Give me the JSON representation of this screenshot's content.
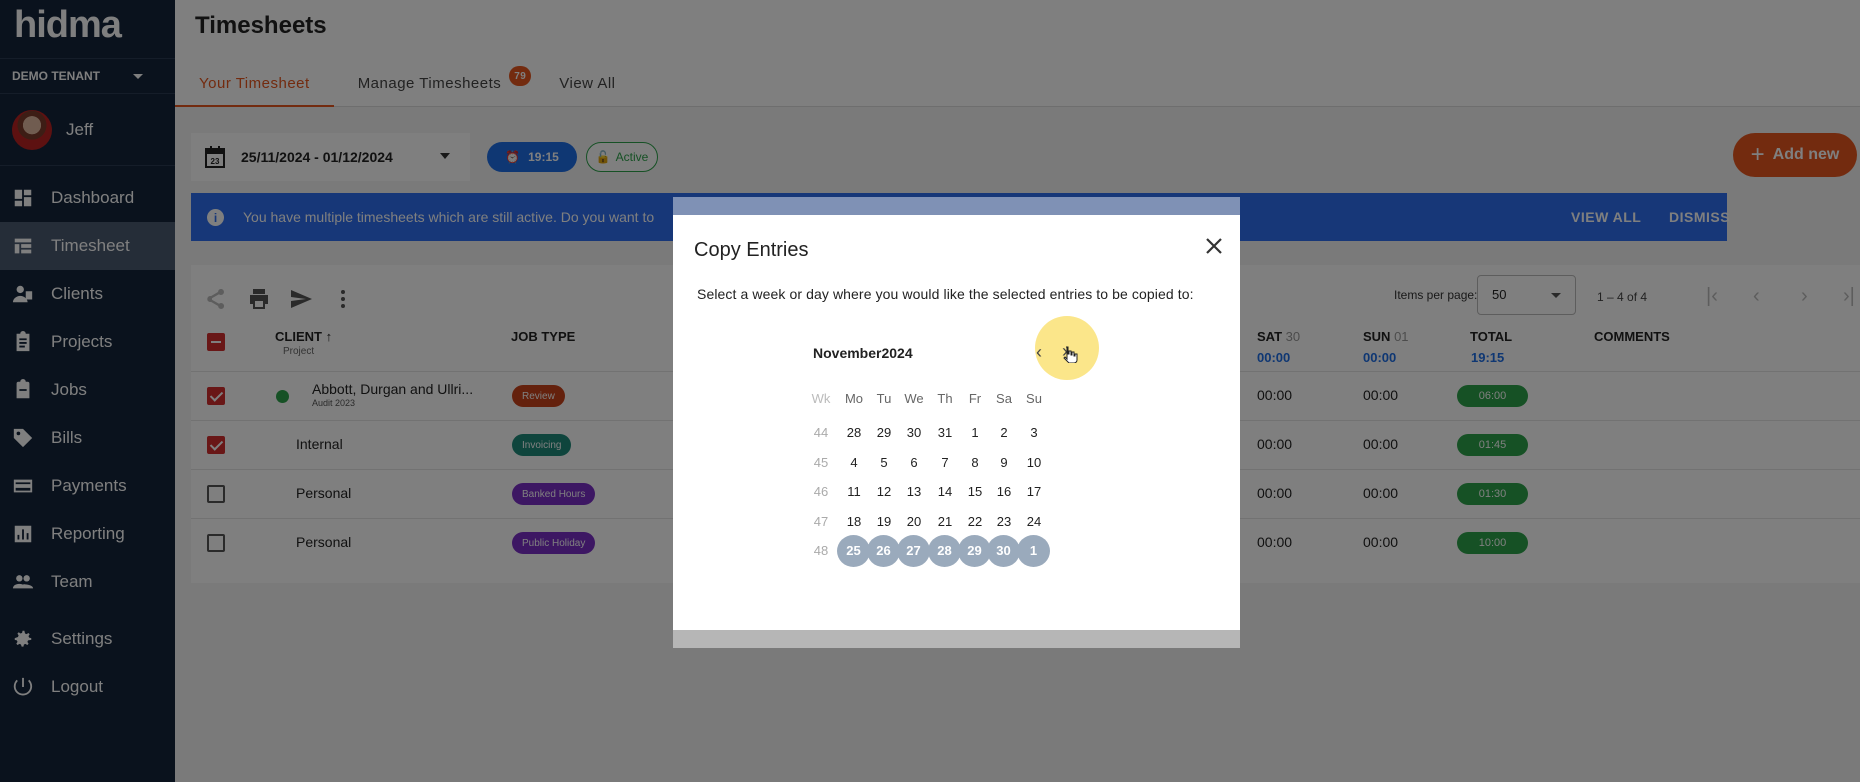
{
  "brand": {
    "logo": "hidma",
    "accent": "#e6561e"
  },
  "tenant": {
    "name": "DEMO TENANT"
  },
  "user": {
    "name": "Jeff"
  },
  "sidebar": {
    "items": [
      {
        "label": "Dashboard",
        "icon": "dashboard-icon"
      },
      {
        "label": "Timesheet",
        "icon": "table-icon",
        "active": true
      },
      {
        "label": "Clients",
        "icon": "clients-icon"
      },
      {
        "label": "Projects",
        "icon": "clipboard-icon"
      },
      {
        "label": "Jobs",
        "icon": "briefcase-icon"
      },
      {
        "label": "Bills",
        "icon": "tag-icon"
      },
      {
        "label": "Payments",
        "icon": "credit-card-icon"
      },
      {
        "label": "Reporting",
        "icon": "chart-icon"
      },
      {
        "label": "Team",
        "icon": "team-icon"
      }
    ],
    "bottom": [
      {
        "label": "Settings",
        "icon": "gear-icon"
      },
      {
        "label": "Logout",
        "icon": "power-icon"
      }
    ]
  },
  "header": {
    "title": "Timesheets",
    "tabs": [
      {
        "label": "Your Timesheet",
        "active": true
      },
      {
        "label": "Manage Timesheets",
        "badge": "79"
      },
      {
        "label": "View All"
      }
    ]
  },
  "toolbar": {
    "date_range": "25/11/2024 - 01/12/2024",
    "calendar_day": "23",
    "time_chip": "19:15",
    "status_chip": "Active",
    "add_new": "Add new"
  },
  "alert": {
    "text": "You have multiple timesheets which are still active. Do you want to",
    "view_all": "VIEW ALL",
    "dismiss": "DISMISS"
  },
  "table": {
    "items_per_page_label": "Items per page:",
    "items_per_page": "50",
    "range": "1 – 4 of 4",
    "headers": {
      "client": "CLIENT",
      "client_sub": "Project",
      "job_type": "JOB TYPE",
      "sat": "SAT",
      "sat_day": "30",
      "sat_val": "00:00",
      "sun": "SUN",
      "sun_day": "01",
      "sun_val": "00:00",
      "total": "TOTAL",
      "total_val": "19:15",
      "comments": "COMMENTS"
    },
    "rows": [
      {
        "client": "Abbott, Durgan and Ullri...",
        "project": "Audit 2023",
        "job": "Review",
        "job_color": "#c8421a",
        "sat": "00:00",
        "sun": "00:00",
        "total": "06:00",
        "checked": true
      },
      {
        "client": "Internal",
        "project": "",
        "job": "Invoicing",
        "job_color": "#1e8a7a",
        "sat": "00:00",
        "sun": "00:00",
        "total": "01:45",
        "checked": true
      },
      {
        "client": "Personal",
        "project": "",
        "job": "Banked Hours",
        "job_color": "#7b2fc7",
        "sat": "00:00",
        "sun": "00:00",
        "total": "01:30",
        "checked": false
      },
      {
        "client": "Personal",
        "project": "",
        "job": "Public Holiday",
        "job_color": "#7b2fc7",
        "sat": "00:00",
        "sun": "00:00",
        "total": "10:00",
        "checked": false
      }
    ]
  },
  "dialog": {
    "title": "Copy Entries",
    "instruction": "Select a week or day where you would like the selected entries to be copied to:",
    "month_label": "November2024",
    "prev": "‹",
    "next": "›",
    "weekday_headers": [
      "Wk",
      "Mo",
      "Tu",
      "We",
      "Th",
      "Fr",
      "Sa",
      "Su"
    ],
    "weeks": [
      {
        "wk": "44",
        "days": [
          "28",
          "29",
          "30",
          "31",
          "1",
          "2",
          "3"
        ]
      },
      {
        "wk": "45",
        "days": [
          "4",
          "5",
          "6",
          "7",
          "8",
          "9",
          "10"
        ]
      },
      {
        "wk": "46",
        "days": [
          "11",
          "12",
          "13",
          "14",
          "15",
          "16",
          "17"
        ]
      },
      {
        "wk": "47",
        "days": [
          "18",
          "19",
          "20",
          "21",
          "22",
          "23",
          "24"
        ]
      },
      {
        "wk": "48",
        "days": [
          "25",
          "26",
          "27",
          "28",
          "29",
          "30",
          "1"
        ],
        "selected": true
      }
    ]
  }
}
